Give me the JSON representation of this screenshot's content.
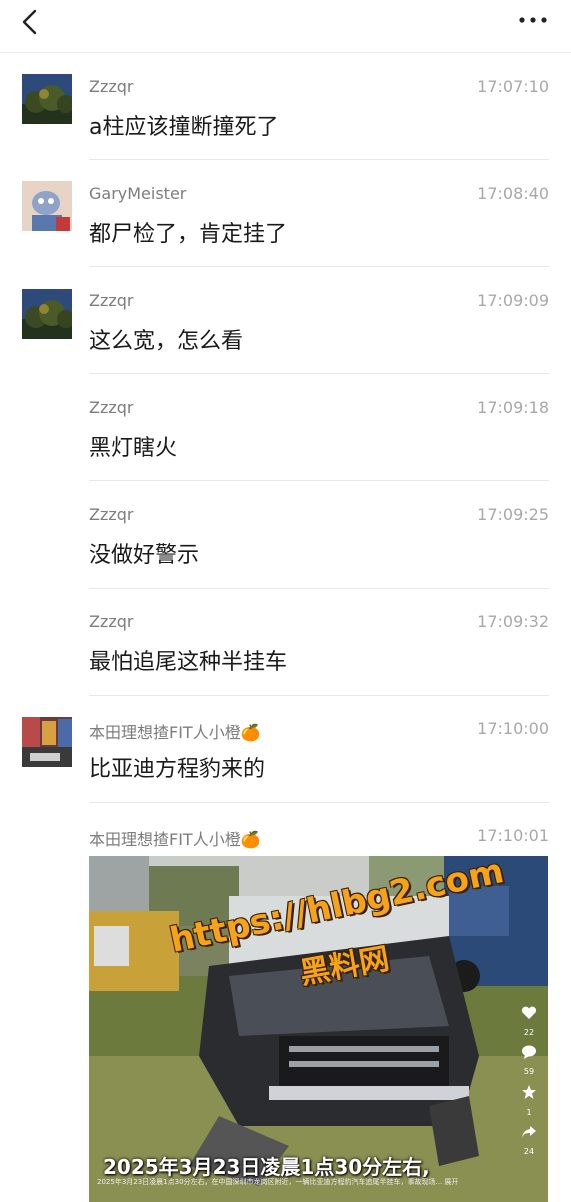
{
  "header": {
    "back_icon": "chevron-left-icon",
    "more_icon": "more-dots-icon"
  },
  "messages": [
    {
      "name": "Zzzqr",
      "time": "17:07:10",
      "text": "a柱应该撞断撞死了",
      "avatar": "trees-avatar"
    },
    {
      "name": "GaryMeister",
      "time": "17:08:40",
      "text": "都尸检了，肯定挂了",
      "avatar": "cartoon-avatar"
    },
    {
      "name": "Zzzqr",
      "time": "17:09:09",
      "text": "这么宽，怎么看",
      "avatar": "trees-avatar"
    },
    {
      "name": "Zzzqr",
      "time": "17:09:18",
      "text": "黑灯瞎火"
    },
    {
      "name": "Zzzqr",
      "time": "17:09:25",
      "text": "没做好警示"
    },
    {
      "name": "Zzzqr",
      "time": "17:09:32",
      "text": "最怕追尾这种半挂车"
    },
    {
      "name": "本田理想揸FIT人小橙🍊",
      "time": "17:10:00",
      "text": "比亚迪方程豹来的",
      "avatar": "street-avatar"
    },
    {
      "name": "本田理想揸FIT人小橙🍊",
      "time": "17:10:01"
    }
  ],
  "post_image": {
    "watermark_url": "https://hlbg2.com",
    "watermark_name": "黑料网",
    "caption": "2025年3月23日凌晨1点30分左右,",
    "likes": "22",
    "comments": "59",
    "stars": "1",
    "shares": "24",
    "small_text": "2025年3月23日凌晨1点30分左右，在中国深圳市龙岗区附近，一辆比亚迪方程豹汽车追尾半挂车，事故现场... 展开"
  }
}
